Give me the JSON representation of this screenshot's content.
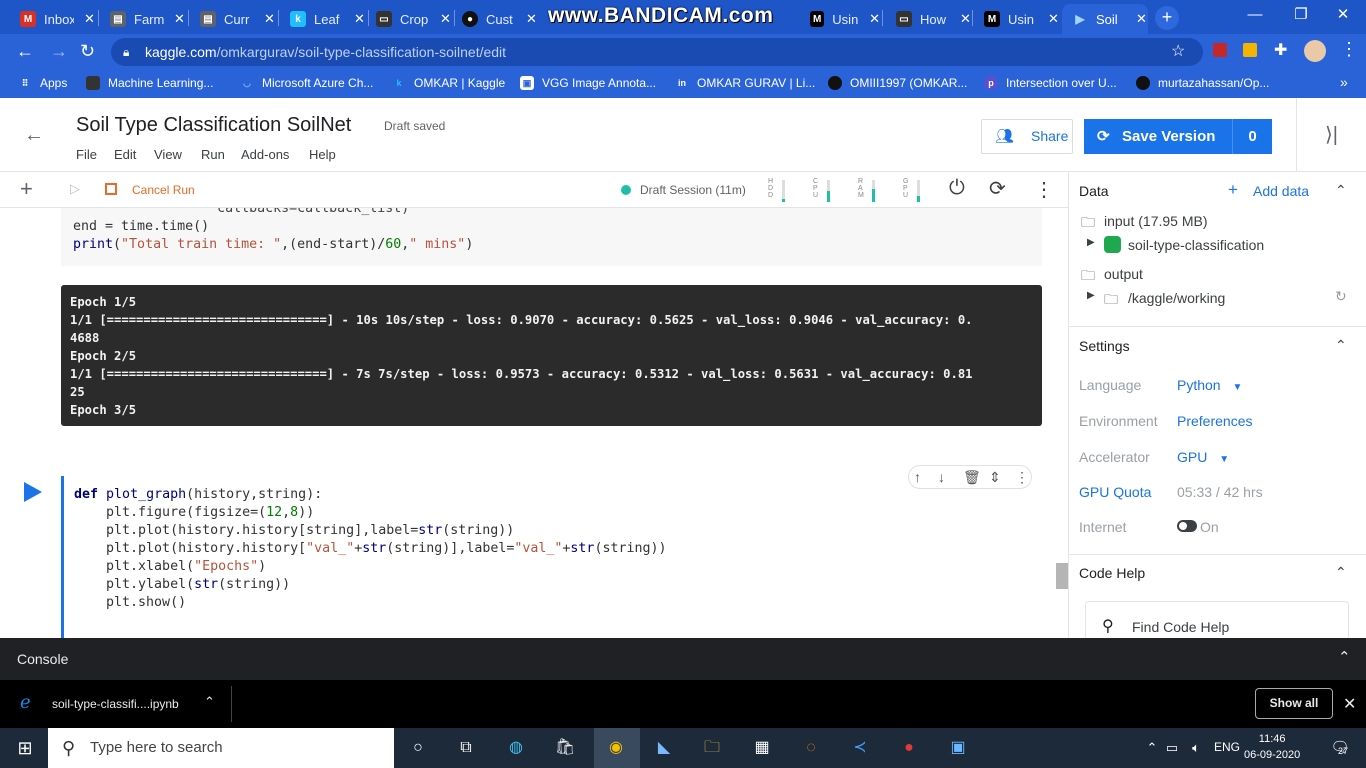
{
  "browser": {
    "tabs": [
      {
        "title": "Inbox",
        "icon": "gmail-icon",
        "color": "#d93025",
        "glyph": "M"
      },
      {
        "title": "Farm",
        "icon": "doc-icon",
        "color": "#5f6368",
        "glyph": "▤"
      },
      {
        "title": "Curr",
        "icon": "doc-icon",
        "color": "#5f6368",
        "glyph": "▤"
      },
      {
        "title": "Leaf",
        "icon": "kaggle-icon",
        "color": "#20beff",
        "glyph": "k"
      },
      {
        "title": "Crop",
        "icon": "medium-icon",
        "color": "#333",
        "glyph": "▭"
      },
      {
        "title": "Cust",
        "icon": "github-icon",
        "color": "#111",
        "glyph": "●"
      },
      {
        "title": "Usin",
        "icon": "medium-icon",
        "color": "#000",
        "glyph": "M"
      },
      {
        "title": "How",
        "icon": "medium-icon",
        "color": "#333",
        "glyph": "▭"
      },
      {
        "title": "Usin",
        "icon": "medium-icon",
        "color": "#000",
        "glyph": "M"
      },
      {
        "title": "Soil",
        "icon": "kaggle-icon",
        "color": "#20beff",
        "glyph": "▶",
        "active": true
      }
    ],
    "watermark": "www.BANDICAM.com",
    "url_host": "kaggle.com",
    "url_path": "/omkargurav/soil-type-classification-soilnet/edit",
    "bookmarks": [
      {
        "label": "Apps",
        "icon": "apps-grid-icon"
      },
      {
        "label": "Machine Learning...",
        "icon": "medium-icon"
      },
      {
        "label": "Microsoft Azure Ch...",
        "icon": "azure-icon"
      },
      {
        "label": "OMKAR | Kaggle",
        "icon": "kaggle-icon"
      },
      {
        "label": "VGG Image Annota...",
        "icon": "vgg-icon"
      },
      {
        "label": "OMKAR GURAV | Li...",
        "icon": "linkedin-icon"
      },
      {
        "label": "OMIII1997 (OMKAR...",
        "icon": "github-icon"
      },
      {
        "label": "Intersection over U...",
        "icon": "pyimagesearch-icon"
      },
      {
        "label": "murtazahassan/Op...",
        "icon": "github-icon"
      }
    ]
  },
  "header": {
    "title": "Soil Type Classification SoilNet",
    "status": "Draft saved",
    "menus": [
      "File",
      "Edit",
      "View",
      "Run",
      "Add-ons",
      "Help"
    ],
    "share_label": "Share",
    "save_label": "Save Version",
    "save_count": "0"
  },
  "toolbar": {
    "cancel_run": "Cancel Run",
    "session": "Draft Session (11m)",
    "meters": [
      {
        "name": "HDD",
        "level": 0.15
      },
      {
        "name": "CPU",
        "level": 0.5
      },
      {
        "name": "RAM",
        "level": 0.6
      },
      {
        "name": "GPU",
        "level": 0.3
      }
    ]
  },
  "cell1": {
    "lines": [
      "                  callbacks=callback_list)",
      "end = time.time()",
      "print(\"Total train time: \",(end-start)/60,\" mins\")"
    ]
  },
  "output": {
    "lines": [
      "Epoch 1/5",
      "1/1 [==============================] - 10s 10s/step - loss: 0.9070 - accuracy: 0.5625 - val_loss: 0.9046 - val_accuracy: 0.",
      "4688",
      "Epoch 2/5",
      "1/1 [==============================] - 7s 7s/step - loss: 0.9573 - accuracy: 0.5312 - val_loss: 0.5631 - val_accuracy: 0.81",
      "25",
      "Epoch 3/5"
    ]
  },
  "cell2": {
    "lines": [
      "def plot_graph(history,string):",
      "    plt.figure(figsize=(12,8))",
      "    plt.plot(history.history[string],label=str(string))",
      "    plt.plot(history.history[\"val_\"+str(string)],label=\"val_\"+str(string))",
      "    plt.xlabel(\"Epochs\")",
      "    plt.ylabel(str(string))",
      "    plt.show()"
    ]
  },
  "sidebar": {
    "data_title": "Data",
    "add_data": "Add data",
    "input_label": "input (17.95 MB)",
    "dataset": "soil-type-classification",
    "output_label": "output",
    "working": "/kaggle/working",
    "settings_title": "Settings",
    "settings": [
      {
        "key": "Language",
        "value": "Python",
        "dropdown": true
      },
      {
        "key": "Environment",
        "value": "Preferences"
      },
      {
        "key": "Accelerator",
        "value": "GPU",
        "dropdown": true
      },
      {
        "key": "GPU Quota",
        "value": "05:33 / 42 hrs"
      },
      {
        "key": "Internet",
        "value": "On"
      }
    ],
    "code_help_title": "Code Help",
    "find_code_help": "Find Code Help"
  },
  "console": {
    "label": "Console"
  },
  "download": {
    "file": "soil-type-classifi....ipynb",
    "show_all": "Show all"
  },
  "taskbar": {
    "search_placeholder": "Type here to search",
    "lang": "ENG",
    "time": "11:46",
    "date": "06-09-2020",
    "notifications": "27"
  }
}
